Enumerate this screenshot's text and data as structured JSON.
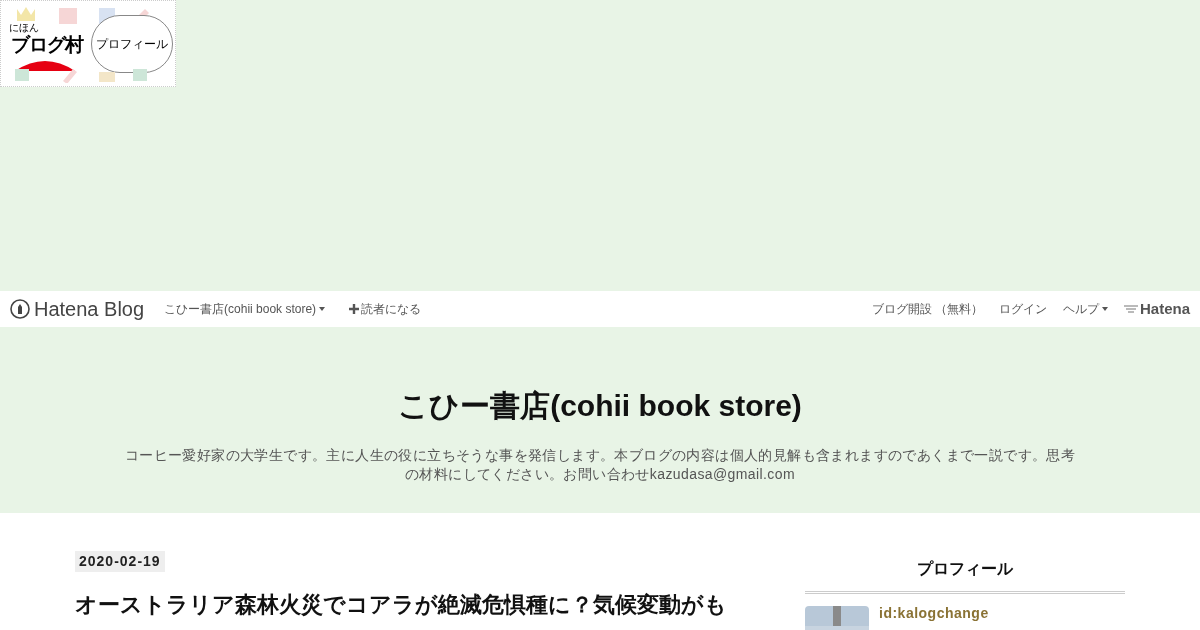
{
  "banner": {
    "small_label": "にほん",
    "logo": "ブログ村",
    "bubble": "プロフィール"
  },
  "global_header": {
    "brand": "Hatena Blog",
    "blog_menu": "こひー書店(cohii book store)",
    "subscribe": "読者になる",
    "links": [
      {
        "label": "ブログ開設 （無料）",
        "dropdown": false
      },
      {
        "label": "ログイン",
        "dropdown": false
      },
      {
        "label": "ヘルプ",
        "dropdown": true
      }
    ],
    "hatena": "Hatena"
  },
  "blog_header": {
    "title": "こひー書店(cohii book store)",
    "description": "コーヒー愛好家の大学生です。主に人生の役に立ちそうな事を発信します。本ブログの内容は個人的見解も含まれますのであくまで一説です。思考の材料にしてください。お問い合わせkazudasa@gmail.com"
  },
  "entry": {
    "date": "2020-02-19",
    "title": "オーストラリア森林火災でコアラが絶滅危惧種に？気候変動がも"
  },
  "sidebar": {
    "module_title": "プロフィール",
    "profile_id": "id:kalogchange"
  }
}
